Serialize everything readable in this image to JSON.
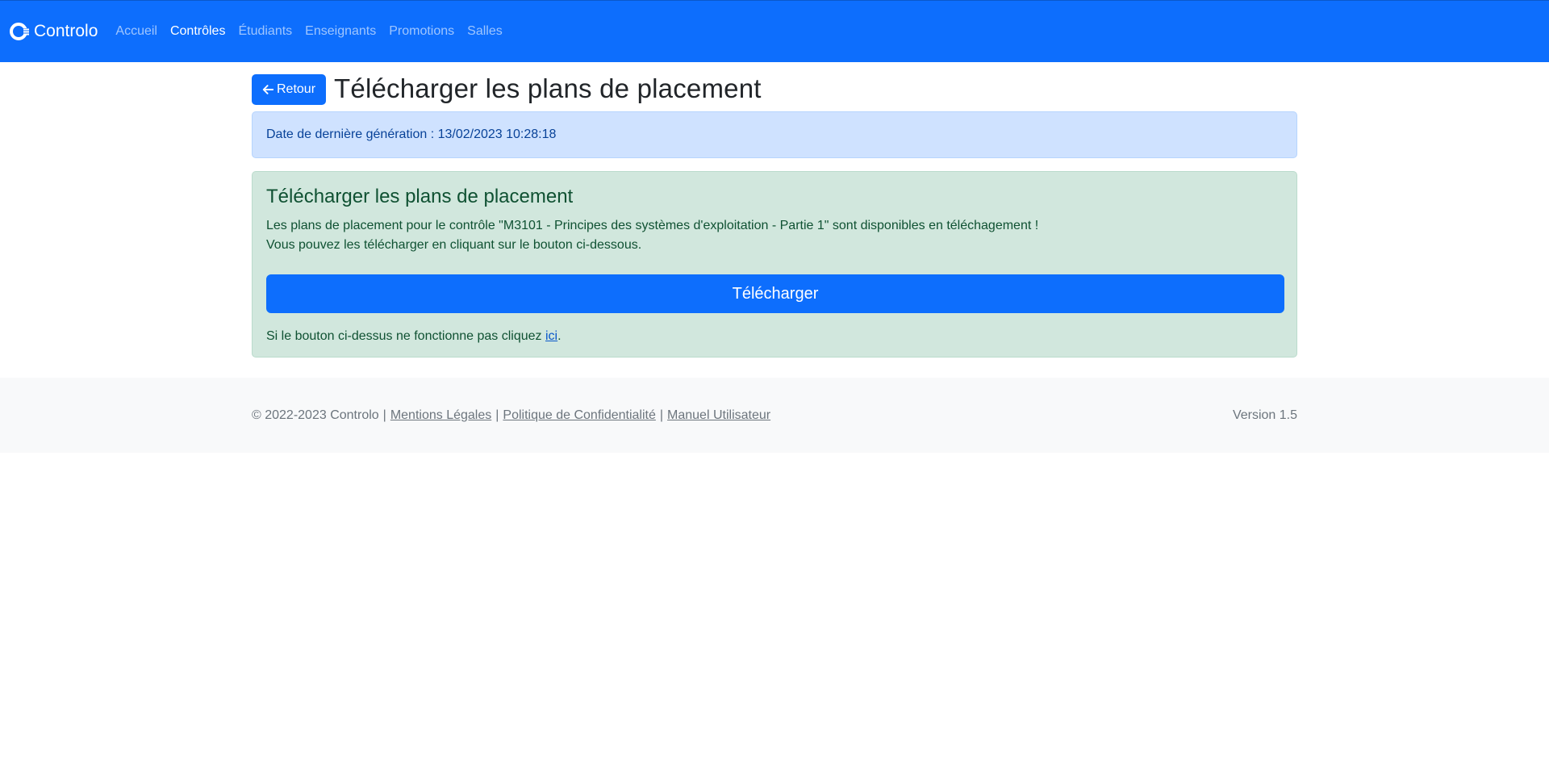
{
  "navbar": {
    "brand": "Controlo",
    "links": [
      {
        "label": "Accueil",
        "active": false
      },
      {
        "label": "Contrôles",
        "active": true
      },
      {
        "label": "Étudiants",
        "active": false
      },
      {
        "label": "Enseignants",
        "active": false
      },
      {
        "label": "Promotions",
        "active": false
      },
      {
        "label": "Salles",
        "active": false
      }
    ]
  },
  "header": {
    "back_label": "Retour",
    "back_icon": "arrow-left-icon",
    "title": "Télécharger les plans de placement"
  },
  "info_alert": {
    "text": "Date de dernière génération : 13/02/2023 10:28:18"
  },
  "success_alert": {
    "heading": "Télécharger les plans de placement",
    "line1": "Les plans de placement pour le contrôle \"M3101 - Principes des systèmes d'exploitation - Partie 1\" sont disponibles en téléchagement !",
    "line2": "Vous pouvez les télécharger en cliquant sur le bouton ci-dessous.",
    "download_label": "Télécharger",
    "fallback_prefix": "Si le bouton ci-dessus ne fonctionne pas cliquez ",
    "fallback_link": "ici",
    "fallback_suffix": "."
  },
  "footer": {
    "copyright": "© 2022-2023 Controlo",
    "links": [
      "Mentions Légales",
      "Politique de Confidentialité",
      "Manuel Utilisateur"
    ],
    "separator": "|",
    "version": "Version 1.5"
  },
  "colors": {
    "primary": "#0d6efd",
    "info_bg": "#cfe2ff",
    "success_bg": "#d1e7dd",
    "footer_bg": "#f8f9fa"
  }
}
